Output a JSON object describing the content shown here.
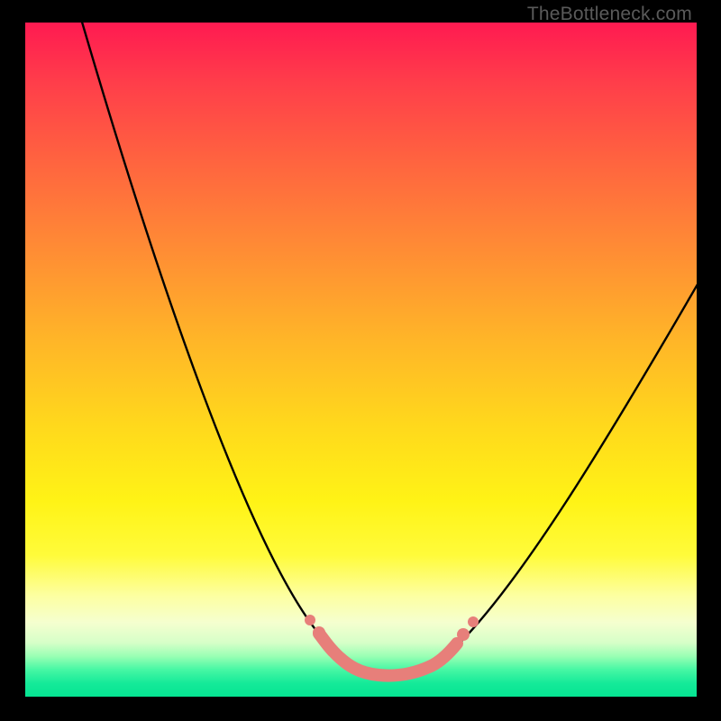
{
  "attribution": "TheBottleneck.com",
  "colors": {
    "frame": "#000000",
    "gradient_top": "#ff1a51",
    "gradient_bottom": "#05e492",
    "curve": "#000000",
    "sweet_spot": "#e77f7a"
  },
  "chart_data": {
    "type": "line",
    "title": "",
    "xlabel": "",
    "ylabel": "",
    "xlim": [
      0,
      100
    ],
    "ylim": [
      0,
      100
    ],
    "series": [
      {
        "name": "bottleneck-curve",
        "x": [
          8,
          15,
          22,
          30,
          38,
          45,
          50,
          55,
          60,
          65,
          72,
          80,
          90,
          100
        ],
        "y": [
          100,
          82,
          64,
          45,
          27,
          12,
          5,
          3,
          4,
          8,
          18,
          32,
          50,
          63
        ]
      }
    ],
    "annotations": [
      {
        "name": "optimal-range",
        "x_range": [
          42,
          67
        ],
        "note": "highlighted pink segment near curve minimum"
      }
    ]
  }
}
